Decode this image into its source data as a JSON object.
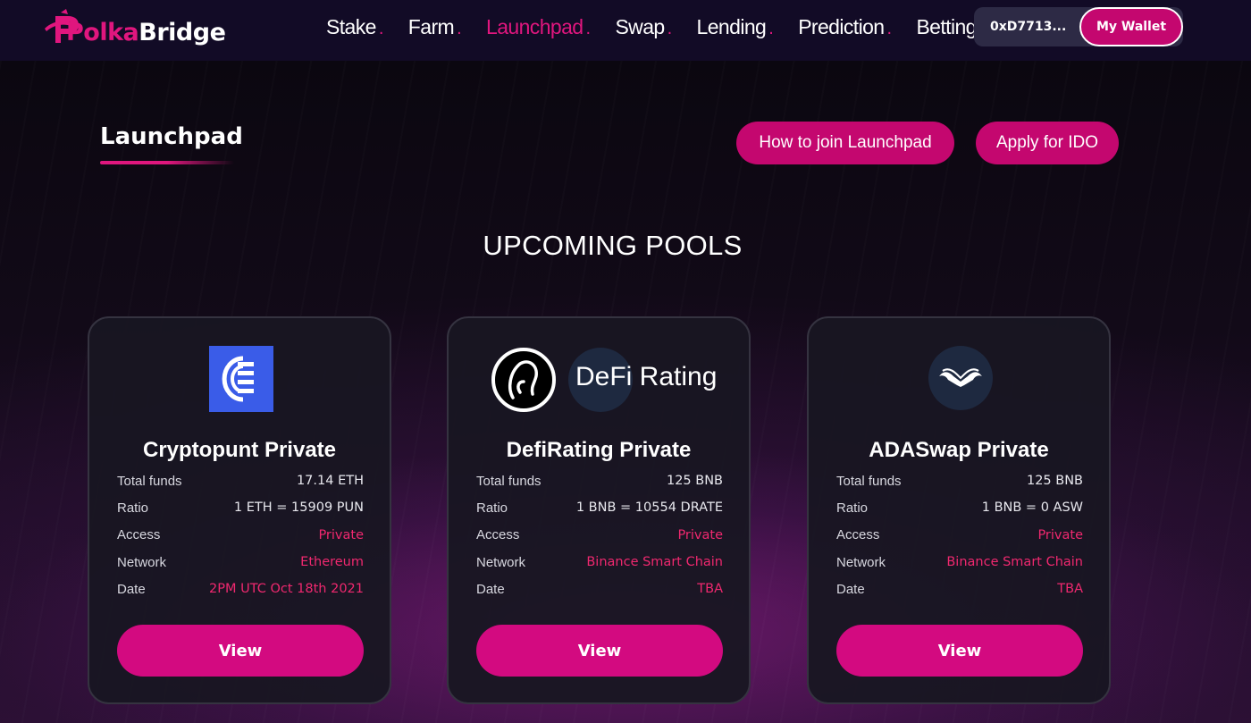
{
  "brand": {
    "name_part1": "Polka",
    "name_part2": "Bridge",
    "logo_letter": "P"
  },
  "nav": {
    "links": [
      {
        "label": "Stake",
        "active": false
      },
      {
        "label": "Farm",
        "active": false
      },
      {
        "label": "Launchpad",
        "active": true
      },
      {
        "label": "Swap",
        "active": false
      },
      {
        "label": "Lending",
        "active": false
      },
      {
        "label": "Prediction",
        "active": false
      },
      {
        "label": "Betting",
        "active": false
      }
    ],
    "dot": ".",
    "wallet_address": "0xD7713...",
    "wallet_button": "My Wallet"
  },
  "header": {
    "title": "Launchpad",
    "join_button": "How to join Launchpad",
    "apply_button": "Apply for IDO"
  },
  "section": {
    "title": "UPCOMING POOLS"
  },
  "pools": [
    {
      "title": "Cryptopunt Private",
      "logo": "cryptopunt-logo",
      "rows": [
        {
          "label": "Total funds",
          "value": "17.14 ETH",
          "highlight": false
        },
        {
          "label": "Ratio",
          "value": "1 ETH = 15909 PUN",
          "highlight": false
        },
        {
          "label": "Access",
          "value": "Private",
          "highlight": true
        },
        {
          "label": "Network",
          "value": "Ethereum",
          "highlight": true
        },
        {
          "label": "Date",
          "value": "2PM UTC Oct 18th 2021",
          "highlight": true
        }
      ],
      "button": "View"
    },
    {
      "title": "DefiRating Private",
      "logo": "defirating-logo",
      "logo_text": "DeFi Rating",
      "rows": [
        {
          "label": "Total funds",
          "value": "125 BNB",
          "highlight": false
        },
        {
          "label": "Ratio",
          "value": "1 BNB = 10554 DRATE",
          "highlight": false
        },
        {
          "label": "Access",
          "value": "Private",
          "highlight": true
        },
        {
          "label": "Network",
          "value": "Binance Smart Chain",
          "highlight": true
        },
        {
          "label": "Date",
          "value": "TBA",
          "highlight": true
        }
      ],
      "button": "View"
    },
    {
      "title": "ADASwap Private",
      "logo": "adaswap-logo",
      "rows": [
        {
          "label": "Total funds",
          "value": "125 BNB",
          "highlight": false
        },
        {
          "label": "Ratio",
          "value": "1 BNB = 0 ASW",
          "highlight": false
        },
        {
          "label": "Access",
          "value": "Private",
          "highlight": true
        },
        {
          "label": "Network",
          "value": "Binance Smart Chain",
          "highlight": true
        },
        {
          "label": "Date",
          "value": "TBA",
          "highlight": true
        }
      ],
      "button": "View"
    }
  ],
  "colors": {
    "accent": "#e0167e",
    "button": "#c4076f",
    "value_highlight": "#f0286f",
    "navbar": "#120b26"
  }
}
